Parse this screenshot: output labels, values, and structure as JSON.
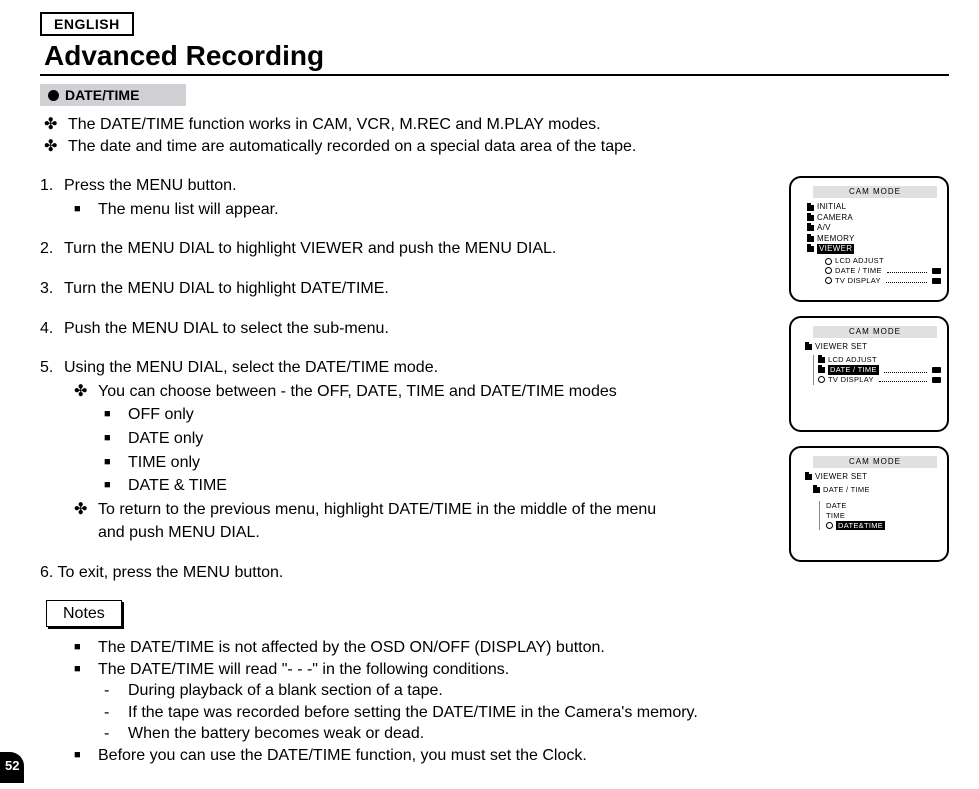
{
  "page_number": "52",
  "language_tab": "ENGLISH",
  "title": "Advanced Recording",
  "section_header": "DATE/TIME",
  "intro": [
    "The DATE/TIME function works in CAM, VCR, M.REC and M.PLAY modes.",
    "The date and time are automatically recorded on a special data area of the tape."
  ],
  "steps": {
    "s1": {
      "n": "1.",
      "text": "Press the MENU button.",
      "sub": [
        "The menu list will appear."
      ]
    },
    "s2": {
      "n": "2.",
      "text": "Turn the MENU DIAL to highlight VIEWER and  push the MENU DIAL."
    },
    "s3": {
      "n": "3.",
      "text": "Turn the MENU DIAL to highlight DATE/TIME."
    },
    "s4": {
      "n": "4.",
      "text": "Push the MENU DIAL to select the sub-menu."
    },
    "s5": {
      "n": "5.",
      "text": "Using the MENU DIAL, select the DATE/TIME mode.",
      "d1": "You can choose between - the OFF, DATE, TIME and DATE/TIME modes",
      "opts": [
        "OFF only",
        "DATE only",
        "TIME only",
        "DATE & TIME"
      ],
      "d2a": "To return to the previous menu, highlight DATE/TIME in the middle of the menu",
      "d2b": "and push MENU DIAL."
    },
    "s6": {
      "n": "6.",
      "text": "To exit, press the MENU button.",
      "nolead": "6. To exit, press the MENU button."
    }
  },
  "notes_label": "Notes",
  "notes": {
    "n1": "The DATE/TIME is not affected by the OSD ON/OFF (DISPLAY) button.",
    "n2": "The DATE/TIME will read \"- - -\" in the following conditions.",
    "n2a": "During playback of a blank section of a tape.",
    "n2b": "If the tape was recorded before setting the DATE/TIME in the Camera's memory.",
    "n2c": "When the battery becomes weak or dead.",
    "n3": "Before you can use the DATE/TIME function, you must set the Clock."
  },
  "screens": {
    "mode_label": "CAM  MODE",
    "s1": {
      "items": [
        "INITIAL",
        "CAMERA",
        "A/V",
        "MEMORY",
        "VIEWER"
      ],
      "sub": [
        "LCD ADJUST",
        "DATE / TIME",
        "TV DISPLAY"
      ]
    },
    "s2": {
      "header": "VIEWER SET",
      "items": [
        "LCD ADJUST",
        "DATE / TIME",
        "TV DISPLAY"
      ]
    },
    "s3": {
      "header": "VIEWER SET",
      "sub_header": "DATE / TIME",
      "opts": [
        "DATE",
        "TIME",
        "DATE&TIME"
      ]
    }
  }
}
